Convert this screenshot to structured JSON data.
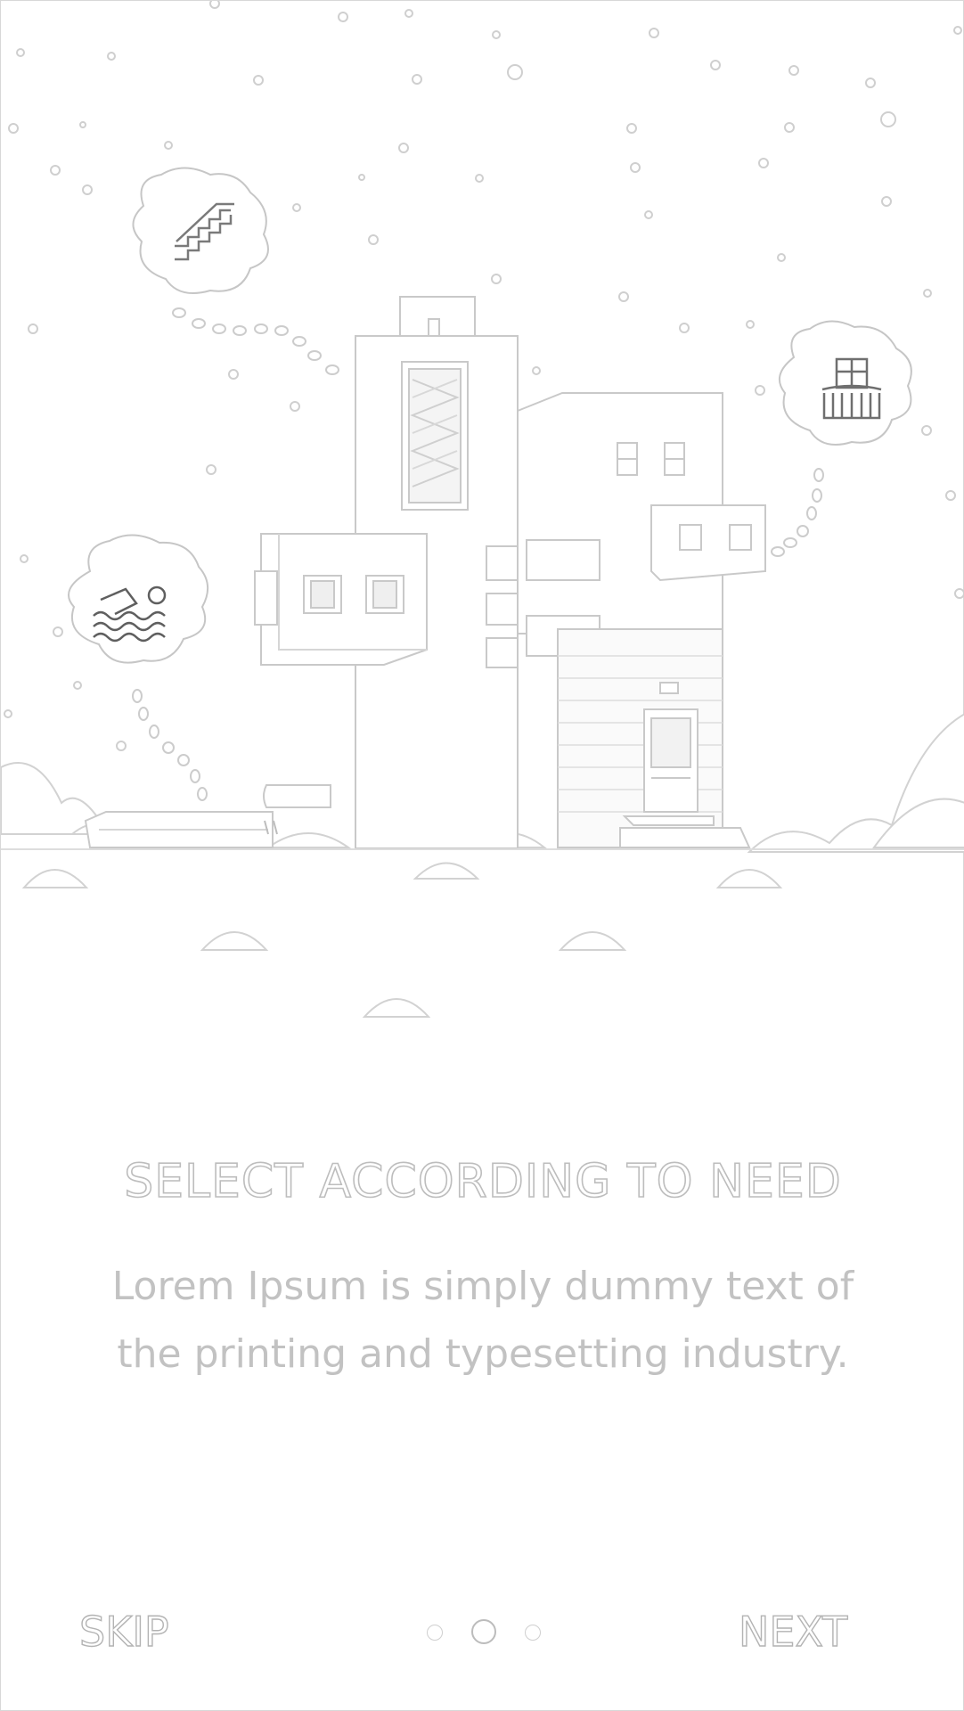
{
  "onboarding": {
    "title": "SELECT ACCORDING TO NEED",
    "description": "Lorem Ipsum is simply dummy text of the printing and typesetting industry.",
    "illustration_icons": [
      "stairs-icon",
      "balcony-icon",
      "swimming-pool-icon"
    ]
  },
  "footer": {
    "skip_label": "SKIP",
    "next_label": "NEXT",
    "pagination": {
      "total": 3,
      "active_index": 1
    }
  },
  "colors": {
    "line": "#bdbdbd",
    "background": "#ffffff"
  }
}
